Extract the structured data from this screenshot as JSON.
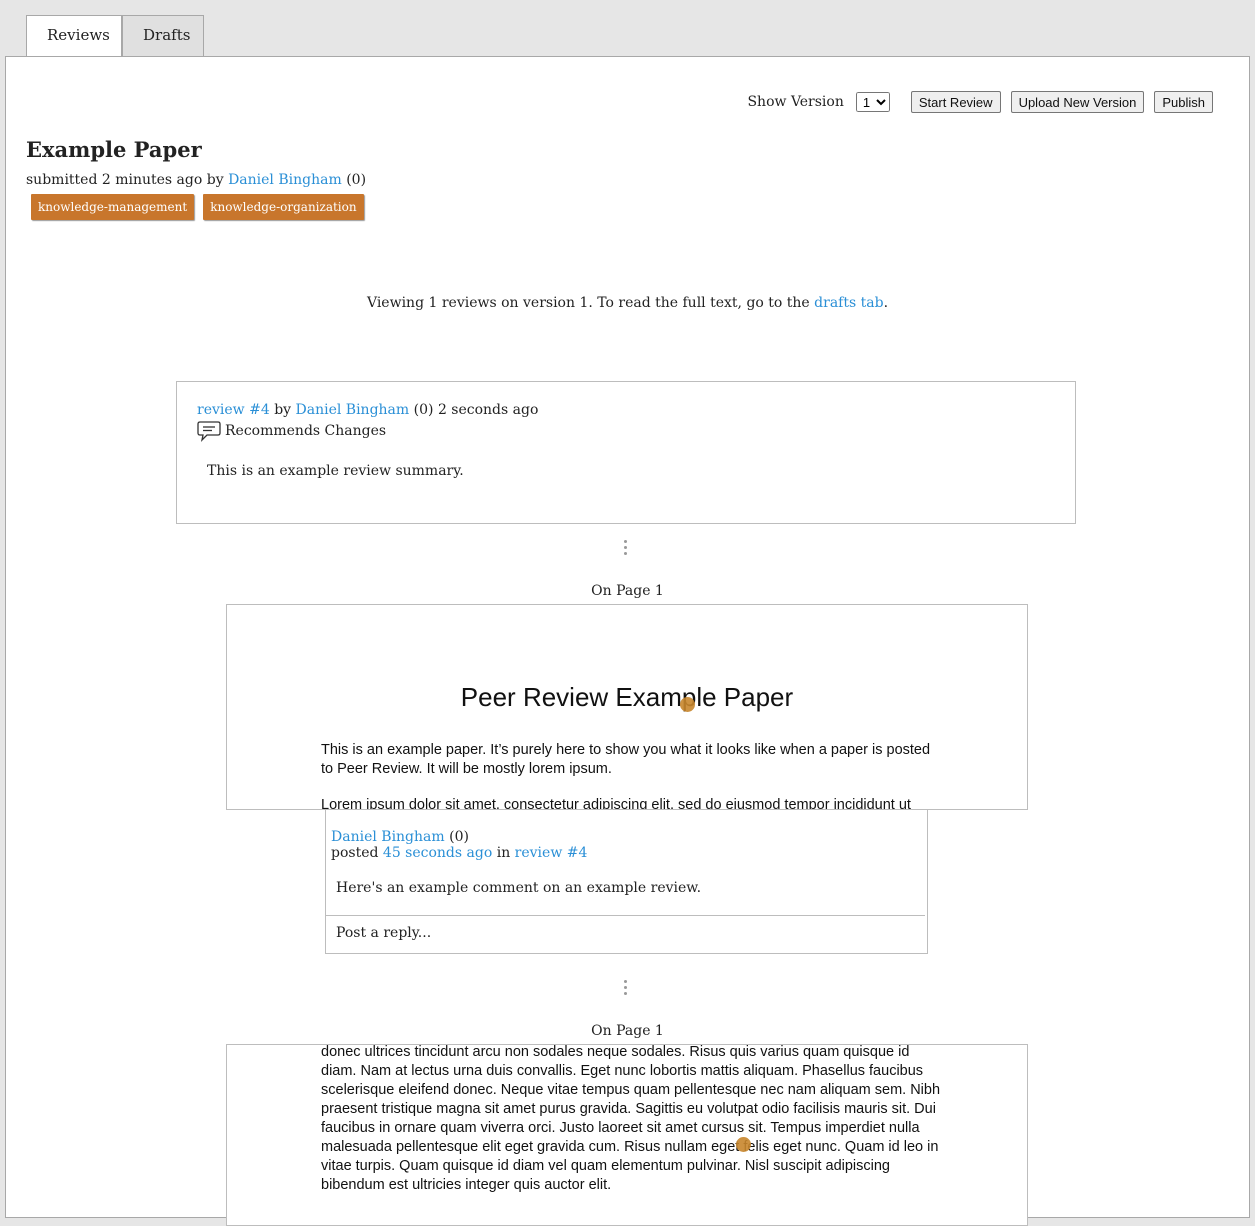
{
  "tabs": [
    {
      "label": "Reviews",
      "active": true
    },
    {
      "label": "Drafts",
      "active": false
    }
  ],
  "toolbar": {
    "show_version_label": "Show Version",
    "version_value": "1",
    "start_review": "Start Review",
    "upload_new_version": "Upload New Version",
    "publish": "Publish"
  },
  "paper": {
    "title": "Example Paper",
    "submitted": "submitted 2 minutes ago",
    "by": "by",
    "author": "Daniel Bingham",
    "author_rep": "(0)",
    "tags": [
      "knowledge-management",
      "knowledge-organization"
    ]
  },
  "viewing": {
    "prefix": "Viewing 1 reviews on version 1. To read the full text, go to the",
    "link": "drafts tab",
    "suffix": "."
  },
  "review": {
    "link": "review #4",
    "by": "by",
    "author": "Daniel Bingham",
    "author_rep": "(0)",
    "time": "2 seconds ago",
    "recommendation": "Recommends Changes",
    "summary": "This is an example review summary."
  },
  "excerpt1": {
    "on_page": "On Page 1",
    "heading": "Peer Review Example Paper",
    "para1": "This is an example paper.  It’s purely here to show you what it looks like when a paper is posted to Peer Review.  It will be mostly lorem ipsum.",
    "para2": "Lorem ipsum dolor sit amet, consectetur adipiscing elit, sed do eiusmod tempor incididunt ut"
  },
  "comment": {
    "author": "Daniel Bingham",
    "author_rep": "(0)",
    "posted": "posted",
    "time": "45 seconds ago",
    "in": "in",
    "review_link": "review #4",
    "text": "Here's an example comment on an example review.",
    "reply_placeholder": "Post a reply..."
  },
  "excerpt2": {
    "on_page": "On Page 1",
    "para": "donec ultrices tincidunt arcu non sodales neque sodales. Risus quis varius quam quisque id diam. Nam at lectus urna duis convallis. Eget nunc lobortis mattis aliquam. Phasellus faucibus scelerisque eleifend donec. Neque vitae tempus quam pellentesque nec nam aliquam sem. Nibh praesent tristique magna sit amet purus gravida. Sagittis eu volutpat odio facilisis mauris sit. Dui faucibus in ornare quam viverra orci. Justo laoreet sit amet cursus sit. Tempus imperdiet nulla malesuada pellentesque elit eget gravida cum. Risus nullam eget felis eget nunc. Quam id leo in vitae turpis. Quam quisque id diam vel quam elementum pulvinar. Nisl suscipit adipiscing bibendum est ultricies integer quis auctor elit."
  },
  "colors": {
    "link": "#2a8fd6",
    "tag_bg": "#c8762c",
    "marker": "#c8862c"
  }
}
